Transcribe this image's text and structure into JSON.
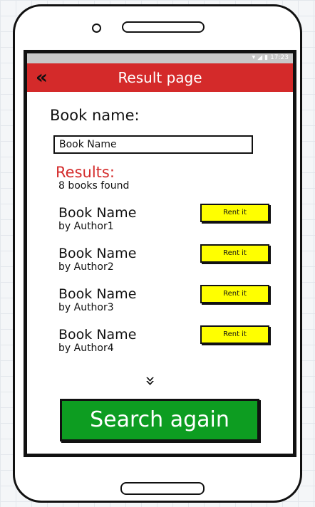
{
  "status": {
    "icons": [
      "wifi-icon",
      "signal-icon",
      "battery-icon"
    ],
    "time": "17:23"
  },
  "header": {
    "back_icon": "double-chevron-left-icon",
    "title": "Result page"
  },
  "search": {
    "label": "Book name:",
    "value": "Book Name"
  },
  "results": {
    "title": "Results:",
    "count": "8 books found",
    "items": [
      {
        "name": "Book Name",
        "author": "by Author1",
        "action": "Rent it"
      },
      {
        "name": "Book Name",
        "author": "by Author2",
        "action": "Rent it"
      },
      {
        "name": "Book Name",
        "author": "by Author3",
        "action": "Rent it"
      },
      {
        "name": "Book Name",
        "author": "by Author4",
        "action": "Rent it"
      }
    ]
  },
  "more_icon": "double-chevron-down-icon",
  "search_again": "Search again",
  "colors": {
    "titlebar": "#d42a2a",
    "results_title": "#d42a2a",
    "rent_button": "#ffff00",
    "search_button": "#0d9d21"
  }
}
